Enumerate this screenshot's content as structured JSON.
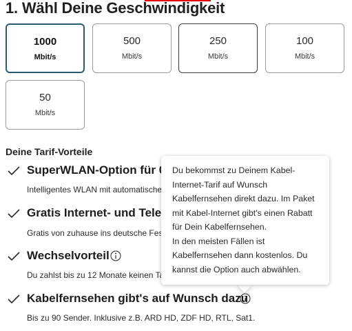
{
  "heading": "1. Wähl Deine Geschwindigkeit",
  "speeds": [
    {
      "value": "1000",
      "unit": "Mbit/s",
      "selected": true
    },
    {
      "value": "500",
      "unit": "Mbit/s",
      "selected": false
    },
    {
      "value": "250",
      "unit": "Mbit/s",
      "selected": false
    },
    {
      "value": "100",
      "unit": "Mbit/s",
      "selected": false
    },
    {
      "value": "50",
      "unit": "Mbit/s",
      "selected": false
    }
  ],
  "benefits_heading": "Deine Tarif-Vorteile",
  "benefits": [
    {
      "title": "SuperWLAN-Option für 0 €",
      "desc": "Intelligentes WLAN mit automatischer Optimierung."
    },
    {
      "title": "Gratis Internet- und Telefon-Flat",
      "desc": "Gratis von zuhause ins deutsche Festnetz und Mobilfunknetz telefonieren."
    },
    {
      "title": "Wechselvorteil",
      "desc": "Du zahlst bis zu 12 Monate keinen Tarifpreis bei uns."
    },
    {
      "title": "Kabelfernsehen gibt's auf Wunsch dazu",
      "desc": "Bis zu 90 Sender. Inklusive z.B. ARD HD, ZDF HD, RTL, Sat1."
    }
  ],
  "tooltip": {
    "lines": [
      "Du bekommst zu Deinem Kabel-",
      "Internet-Tarif auf Wunsch",
      "Kabelfernsehen direkt dazu. Im Paket",
      "mit Kabel-Internet gibt's einen Rabatt",
      "für Dein Kabelfernsehen.",
      "In den meisten Fällen ist",
      "Kabelfernsehen dann kostenlos. Du",
      "kannst die Option auch abwählen."
    ]
  },
  "icons": {
    "check": "check-icon",
    "info": "info-icon"
  },
  "colors": {
    "accent_red": "#e60000",
    "selected_border": "#2a5a6e"
  }
}
